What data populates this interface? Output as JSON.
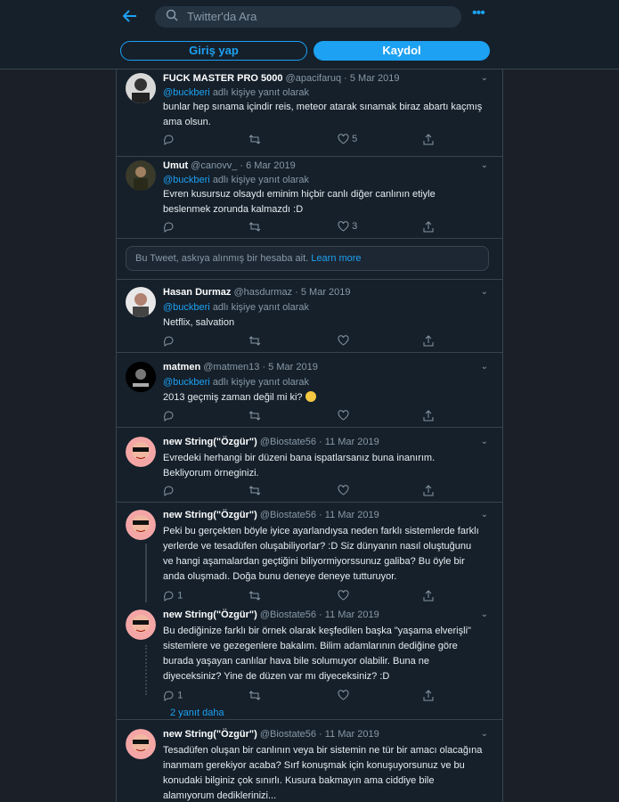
{
  "header": {
    "search_placeholder": "Twitter'da Ara",
    "login_label": "Giriş yap",
    "signup_label": "Kaydol"
  },
  "reply_text": "adlı kişiye yanıt olarak",
  "tweets": [
    {
      "name": "FUCK MASTER PRO 5000",
      "handle": "@apacifaruq",
      "date": "5 Mar 2019",
      "reply_to": "@buckberi",
      "text": "bunlar hep sınama içindir reis, meteor atarak sınamak biraz abartı kaçmış ama olsun.",
      "replies": "",
      "retweets": "",
      "likes": "5"
    },
    {
      "name": "Umut",
      "handle": "@canovv_",
      "date": "6 Mar 2019",
      "reply_to": "@buckberi",
      "text": "Evren kusursuz olsaydı eminim hiçbir canlı diğer canlının etiyle beslenmek zorunda kalmazdı :D",
      "replies": "",
      "retweets": "",
      "likes": "3"
    },
    {
      "name": "Hasan Durmaz",
      "handle": "@hasdurmaz",
      "date": "5 Mar 2019",
      "reply_to": "@buckberi",
      "text": "Netflix, salvation",
      "replies": "",
      "retweets": "",
      "likes": ""
    },
    {
      "name": "matmen",
      "handle": "@matmen13",
      "date": "5 Mar 2019",
      "reply_to": "@buckberi",
      "text": "2013 geçmiş zaman değil mi ki?",
      "replies": "",
      "retweets": "",
      "likes": ""
    },
    {
      "name": "new String(\"Özgür\")",
      "handle": "@Biostate56",
      "date": "11 Mar 2019",
      "reply_to": "",
      "text": "Evredeki herhangi bir düzeni bana ispatlarsanız buna inanırım. Bekliyorum örneginizi.",
      "replies": "",
      "retweets": "",
      "likes": ""
    },
    {
      "name": "new String(\"Özgür\")",
      "handle": "@Biostate56",
      "date": "11 Mar 2019",
      "reply_to": "",
      "text": "Peki bu gerçekten böyle iyice ayarlandıysa neden farklı sistemlerde farklı yerlerde ve tesadüfen oluşabiliyorlar? :D Siz dünyanın nasıl oluştuğunu ve hangi aşamalardan geçtiğini biliyormiyorssunuz galiba? Bu öyle bir anda oluşmadı. Doğa bunu deneye deneye tutturuyor.",
      "replies": "1",
      "retweets": "",
      "likes": ""
    },
    {
      "name": "new String(\"Özgür\")",
      "handle": "@Biostate56",
      "date": "11 Mar 2019",
      "reply_to": "",
      "text": "Bu dediğinize farklı bir örnek olarak keşfedilen başka \"yaşama elverişli\" sistemlere ve gezegenlere bakalım. Bilim adamlarının dediğine göre burada yaşayan canlılar hava bile solumuyor olabilir. Buna ne diyeceksiniz? Yine de düzen var mı diyeceksiniz? :D",
      "replies": "1",
      "retweets": "",
      "likes": ""
    },
    {
      "name": "new String(\"Özgür\")",
      "handle": "@Biostate56",
      "date": "11 Mar 2019",
      "reply_to": "",
      "text": "Tesadüfen oluşan bir canlının veya bir sistemin ne tür bir amacı olacağına inanmam gerekiyor acaba? Sırf konuşmak için konuşuyorsunuz ve bu konudaki bilginiz çok sınırlı. Kusura bakmayın ama ciddiye bile alamıyorum dediklerinizi...",
      "replies": "",
      "retweets": "",
      "likes": ""
    }
  ],
  "notice": {
    "text": "Bu Tweet, askıya alınmış bir hesaba ait.",
    "link": "Learn more"
  },
  "more_replies": "2 yanıt daha"
}
